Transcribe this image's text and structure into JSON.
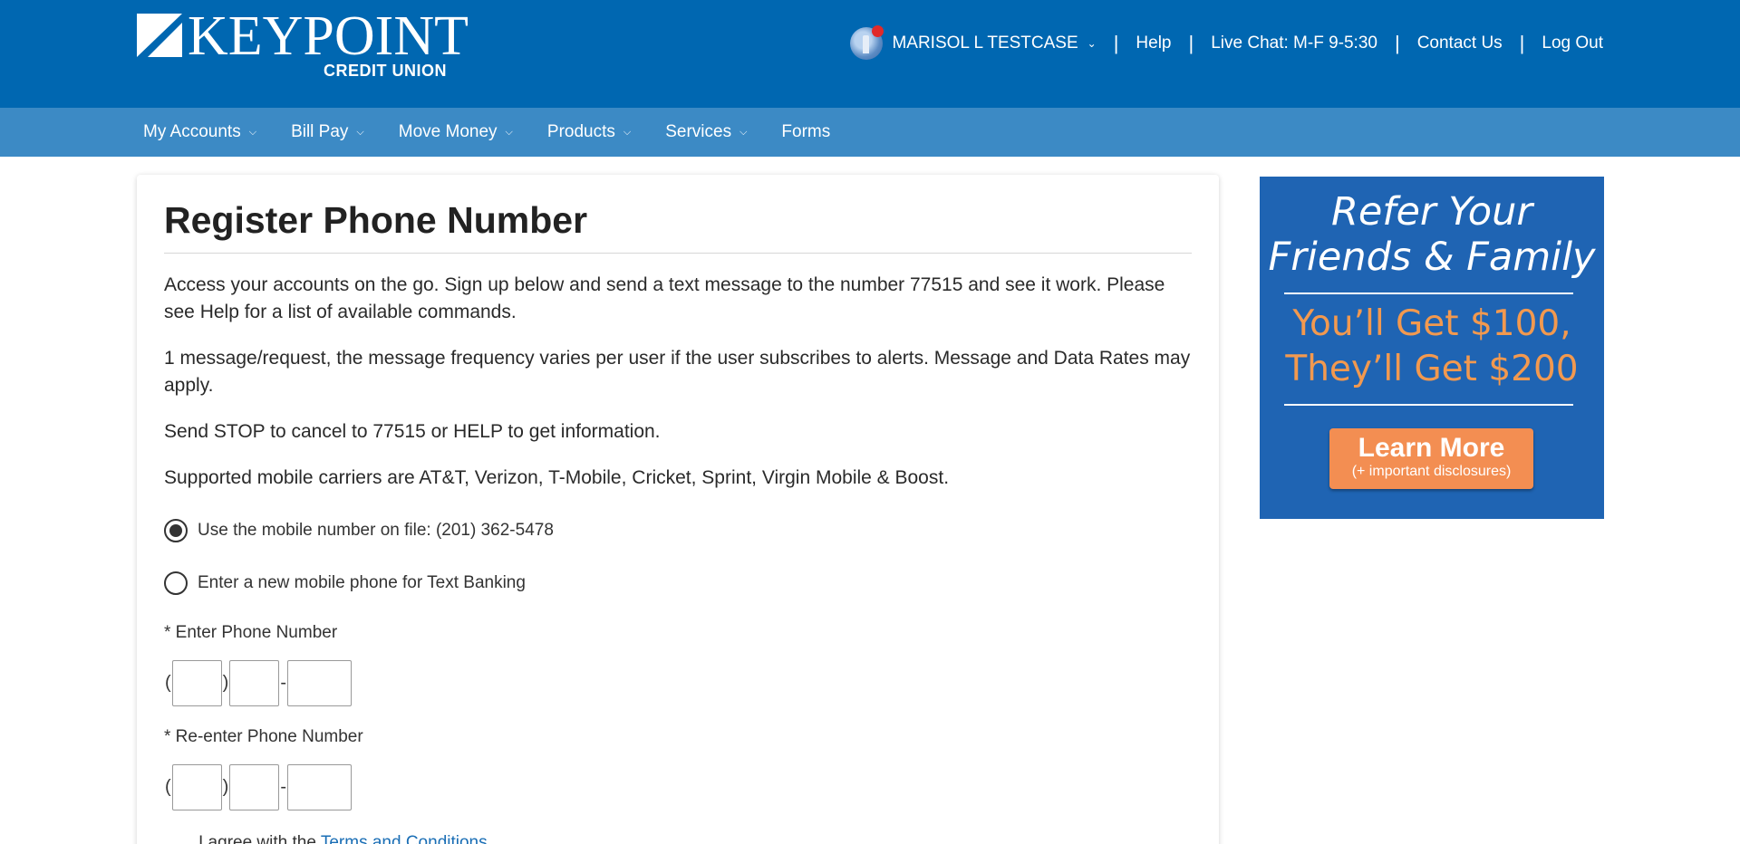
{
  "header": {
    "logo_text": "KEYPOINT",
    "logo_sub": "CREDIT UNION",
    "user_name": "MARISOL L TESTCASE",
    "links": [
      "Help",
      "Live Chat: M-F 9-5:30",
      "Contact Us",
      "Log Out"
    ],
    "separator": "|"
  },
  "nav": {
    "items": [
      {
        "label": "My Accounts",
        "dropdown": true
      },
      {
        "label": "Bill Pay",
        "dropdown": true
      },
      {
        "label": "Move Money",
        "dropdown": true
      },
      {
        "label": "Products",
        "dropdown": true
      },
      {
        "label": "Services",
        "dropdown": true
      },
      {
        "label": "Forms",
        "dropdown": false
      }
    ]
  },
  "page": {
    "title": "Register Phone Number",
    "paragraphs": [
      "Access your accounts on the go. Sign up below and send a text message to the number 77515 and see it work. Please see Help for a list of available commands.",
      "1 message/request, the message frequency varies per user if the user subscribes to alerts. Message and Data Rates may apply.",
      "Send STOP to cancel to 77515 or HELP to get information.",
      "Supported mobile carriers are AT&T, Verizon, T-Mobile, Cricket, Sprint, Virgin Mobile & Boost."
    ],
    "options": [
      {
        "label": "Use the mobile number on file: (201) 362-5478",
        "checked": true
      },
      {
        "label": "Enter a new mobile phone for Text Banking",
        "checked": false
      }
    ],
    "phone_label": "* Enter Phone Number",
    "phone_reenter_label": "* Re-enter Phone Number",
    "phone_values": {
      "area": "",
      "prefix": "",
      "line": ""
    },
    "phone_reenter_values": {
      "area": "",
      "prefix": "",
      "line": ""
    },
    "paren_open": "(",
    "paren_close": ")",
    "dash": "-",
    "agree_text": "I agree with the ",
    "agree_link": "Terms and Conditions"
  },
  "promo": {
    "headline_1": "Refer Your",
    "headline_2": "Friends & Family",
    "offer_1": "You’ll Get $100,",
    "offer_2": "They’ll Get $200",
    "button_label": "Learn More",
    "button_sub": "(+ important disclosures)"
  },
  "colors": {
    "header_bg": "#0067b1",
    "nav_bg": "#3c8ac5",
    "promo_bg": "#1f64b3",
    "promo_accent": "#f38e52",
    "link": "#1a6eb5"
  },
  "icons": {
    "dropdown": "chevron-down-icon",
    "notification": "notification-dot-icon"
  }
}
